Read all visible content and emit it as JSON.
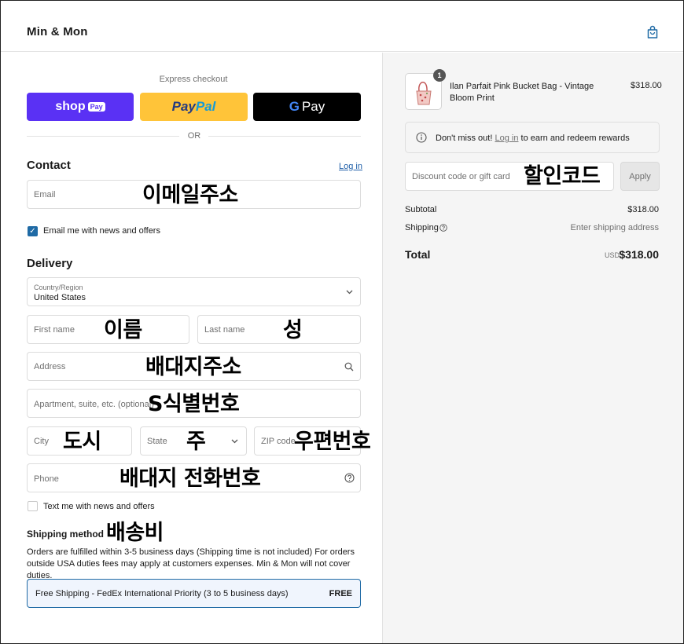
{
  "header": {
    "brand": "Min & Mon",
    "cart_icon": "shopping-bag-icon"
  },
  "express": {
    "label": "Express checkout",
    "shop_pay": {
      "main": "shop",
      "pill": "Pay"
    },
    "paypal": {
      "pay": "Pay",
      "pal": "Pal"
    },
    "gpay": {
      "g": "G",
      "pay": "Pay"
    },
    "or": "OR"
  },
  "contact": {
    "heading": "Contact",
    "login_link": "Log in",
    "email_placeholder": "Email",
    "email_annotation": "이메일주소",
    "newsletter_label": "Email me with news and offers",
    "newsletter_checked": true
  },
  "delivery": {
    "heading": "Delivery",
    "country_label": "Country/Region",
    "country_value": "United States",
    "first_name_placeholder": "First name",
    "first_name_annotation": "이름",
    "last_name_placeholder": "Last name",
    "last_name_annotation": "성",
    "address_placeholder": "Address",
    "address_annotation": "배대지주소",
    "apartment_placeholder": "Apartment, suite, etc. (optional)",
    "apartment_annotation": "S식별번호",
    "city_placeholder": "City",
    "city_annotation": "도시",
    "state_placeholder": "State",
    "state_annotation": "주",
    "zip_placeholder": "ZIP code",
    "zip_annotation": "우편번호",
    "phone_placeholder": "Phone",
    "phone_annotation": "배대지 전화번호",
    "sms_label": "Text me with news and offers",
    "sms_checked": false
  },
  "shipping": {
    "heading": "Shipping method",
    "annotation": "배송비",
    "notice": "Orders are fulfilled within 3-5 business days (Shipping time is not included) For orders outside USA duties fees may apply at customers expenses. Min & Mon will not cover duties.",
    "option_label": "Free Shipping - FedEx International Priority (3 to 5 business days)",
    "option_price": "FREE"
  },
  "summary": {
    "product": {
      "quantity": "1",
      "name": "Ilan Parfait Pink Bucket Bag - Vintage Bloom Print",
      "price": "$318.00"
    },
    "rewards": {
      "prefix": "Don't miss out!",
      "link": "Log in",
      "suffix": "to earn and redeem rewards"
    },
    "discount_placeholder": "Discount code or gift card",
    "discount_annotation": "할인코드",
    "apply_label": "Apply",
    "subtotal_label": "Subtotal",
    "subtotal_value": "$318.00",
    "shipping_label": "Shipping",
    "shipping_value": "Enter shipping address",
    "total_label": "Total",
    "total_currency": "USD",
    "total_value": "$318.00"
  },
  "colors": {
    "shop_pay": "#5a31f4",
    "paypal": "#ffc439",
    "gpay": "#000000",
    "accent": "#1f6aa5",
    "summary_bg": "#f5f5f5"
  }
}
